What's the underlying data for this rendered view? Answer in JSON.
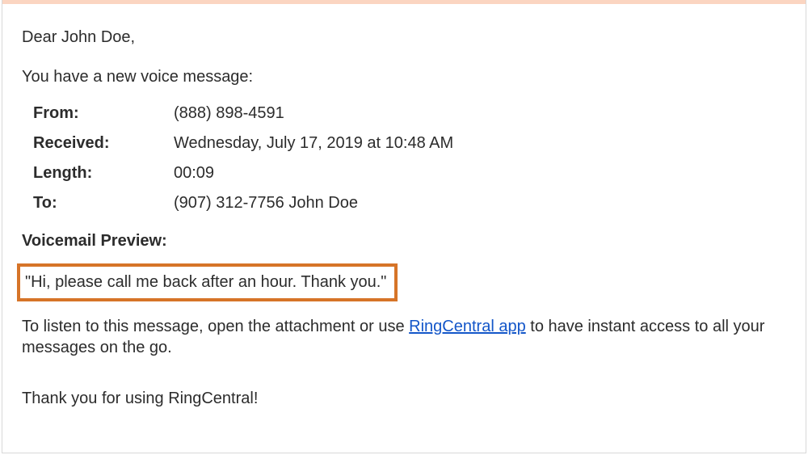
{
  "greeting": "Dear John Doe,",
  "intro": "You have a new voice message:",
  "details": {
    "from_label": "From:",
    "from_value": "(888) 898-4591",
    "received_label": "Received:",
    "received_value": "Wednesday, July 17, 2019 at 10:48 AM",
    "length_label": "Length:",
    "length_value": "00:09",
    "to_label": "To:",
    "to_value": "(907) 312-7756 John Doe"
  },
  "preview_heading": "Voicemail Preview:",
  "preview_text": "\"Hi, please call me back after an hour. Thank you.\"",
  "instruction_pre": "To listen to this message, open the attachment or use ",
  "instruction_link": "RingCentral app",
  "instruction_post": " to have instant access to all your messages on the go.",
  "thanks": "Thank you for using RingCentral!"
}
